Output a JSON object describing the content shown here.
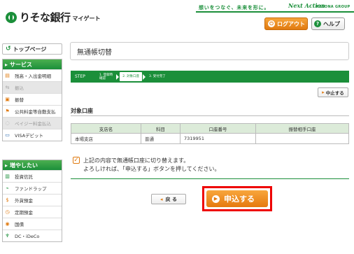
{
  "header": {
    "bank_name": "りそな銀行",
    "sub_label": "マイゲート",
    "slogan": "想いをつなぐ、未来を形に。",
    "brand_script": "Next Action",
    "group_name": "RESONA GROUP",
    "logout_label": "ログアウト",
    "help_label": "ヘルプ"
  },
  "sidebar": {
    "top_page": "トップページ",
    "services_title": "サービス",
    "services": [
      {
        "label": "残高・入出金明細",
        "disabled": false,
        "icon": "yen-icon"
      },
      {
        "label": "振込",
        "disabled": true,
        "icon": "transfer-icon"
      },
      {
        "label": "振替",
        "disabled": false,
        "icon": "exchange-icon"
      },
      {
        "label": "公共料金等自動支払",
        "disabled": false,
        "icon": "bill-icon"
      },
      {
        "label": "ペイジー料金払込",
        "disabled": true,
        "icon": "payeasy-icon"
      },
      {
        "label": "VISAデビット",
        "disabled": false,
        "icon": "card-icon"
      }
    ],
    "grow_title": "増やしたい",
    "grow": [
      {
        "label": "投資信託",
        "icon": "chart-icon"
      },
      {
        "label": "ファンドラップ",
        "icon": "wrap-icon"
      },
      {
        "label": "外貨預金",
        "icon": "currency-icon"
      },
      {
        "label": "定期預金",
        "icon": "deposit-icon"
      },
      {
        "label": "国債",
        "icon": "bond-icon"
      },
      {
        "label": "DC・iDeCo",
        "icon": "pension-icon"
      }
    ]
  },
  "main": {
    "title": "無通帳切替",
    "step_label": "STEP",
    "steps": [
      {
        "label": "1. 登録時\n確認",
        "current": false
      },
      {
        "label": "2. 対象口座",
        "current": true
      },
      {
        "label": "3. 受付完了",
        "current": false
      }
    ],
    "stop_label": "中止する",
    "section_title": "対象口座",
    "table": {
      "headers": [
        "支店名",
        "科目",
        "口座番号",
        "振替相手口座"
      ],
      "rows": [
        [
          "本場支店",
          "普通",
          "7319951",
          ""
        ]
      ]
    },
    "confirm_line1": "上記の内容で無通帳口座に切り替えます。",
    "confirm_line2": "よろしければ、「申込する」ボタンを押してください。",
    "back_label": "戻 る",
    "apply_label": "申込する"
  },
  "colors": {
    "brand_green": "#1b8f3a",
    "accent_orange": "#e57a0f",
    "highlight_red": "#ee0000"
  }
}
